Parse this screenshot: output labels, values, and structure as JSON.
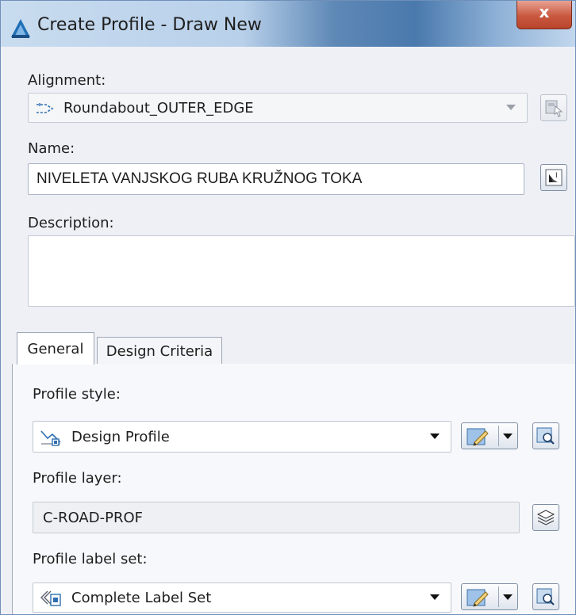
{
  "window": {
    "title": "Create Profile - Draw New",
    "close_glyph": "x"
  },
  "alignment": {
    "label": "Alignment:",
    "value": "Roundabout_OUTER_EDGE",
    "icon": "alignment-icon"
  },
  "name": {
    "label": "Name:",
    "value": "NIVELETA VANJSKOG RUBA KRUŽNOG TOKA"
  },
  "description": {
    "label": "Description:",
    "value": ""
  },
  "tabs": [
    {
      "label": "General",
      "active": true
    },
    {
      "label": "Design Criteria",
      "active": false
    }
  ],
  "general": {
    "profile_style": {
      "label": "Profile style:",
      "value": "Design Profile"
    },
    "profile_layer": {
      "label": "Profile layer:",
      "value": "C-ROAD-PROF"
    },
    "profile_label_set": {
      "label": "Profile label set:",
      "value": "Complete Label Set"
    }
  },
  "colors": {
    "accent": "#2f6fb0",
    "window_bg": "#eef0f6",
    "title_gradient_dark": "#4a79ad",
    "close_button": "#c9583f"
  }
}
